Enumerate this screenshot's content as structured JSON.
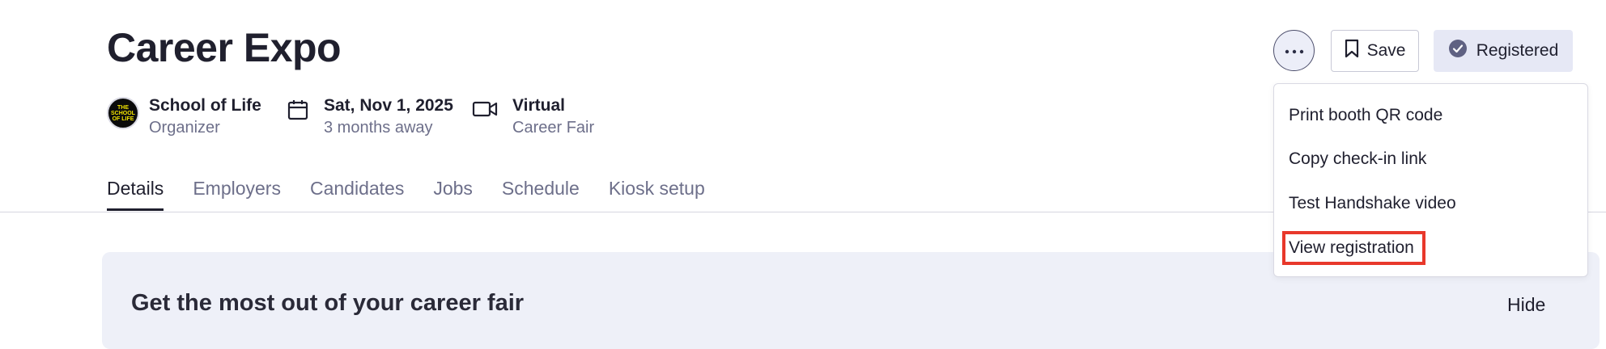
{
  "event": {
    "title": "Career Expo"
  },
  "meta": {
    "organizer": {
      "name": "School of Life",
      "role": "Organizer",
      "logo_text": "THE SCHOOL OF LIFE"
    },
    "date": {
      "value": "Sat, Nov 1, 2025",
      "relative": "3 months away"
    },
    "format": {
      "value": "Virtual",
      "type": "Career Fair"
    }
  },
  "tabs": [
    {
      "label": "Details",
      "active": true
    },
    {
      "label": "Employers"
    },
    {
      "label": "Candidates"
    },
    {
      "label": "Jobs"
    },
    {
      "label": "Schedule"
    },
    {
      "label": "Kiosk setup"
    }
  ],
  "actions": {
    "save_label": "Save",
    "registered_label": "Registered"
  },
  "dropdown": {
    "items": [
      {
        "label": "Print booth QR code"
      },
      {
        "label": "Copy check-in link"
      },
      {
        "label": "Test Handshake video"
      },
      {
        "label": "View registration",
        "highlighted": true
      }
    ]
  },
  "banner": {
    "title": "Get the most out of your career fair",
    "hide_label": "Hide"
  },
  "colors": {
    "highlight_border": "#e8382b",
    "registered_bg": "#e6e8f5",
    "banner_bg": "#eef0f8"
  }
}
